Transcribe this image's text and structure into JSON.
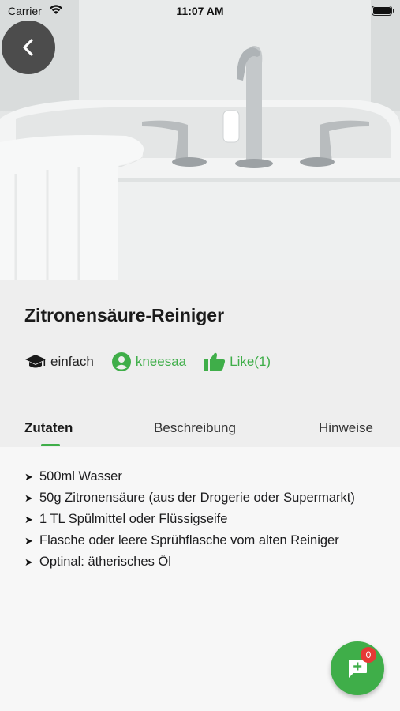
{
  "status_bar": {
    "carrier": "Carrier",
    "time": "11:07 AM"
  },
  "recipe": {
    "title": "Zitronensäure-Reiniger",
    "difficulty": "einfach",
    "author": "kneesaa",
    "like_label": "Like(1)"
  },
  "tabs": [
    {
      "label": "Zutaten",
      "active": true
    },
    {
      "label": "Beschreibung",
      "active": false
    },
    {
      "label": "Hinweise",
      "active": false
    }
  ],
  "ingredients": [
    "500ml Wasser",
    "50g Zitronensäure (aus der Drogerie oder Supermarkt)",
    "1 TL Spülmittel oder Flüssigseife",
    "Flasche oder leere Sprühflasche vom alten Reiniger",
    "Optinal: ätherisches Öl"
  ],
  "list_bullet": "➤",
  "fab": {
    "badge_count": "0",
    "icon": "add-comment-icon"
  },
  "colors": {
    "accent": "#3fae49",
    "badge": "#e53935",
    "back_button": "#323232"
  }
}
